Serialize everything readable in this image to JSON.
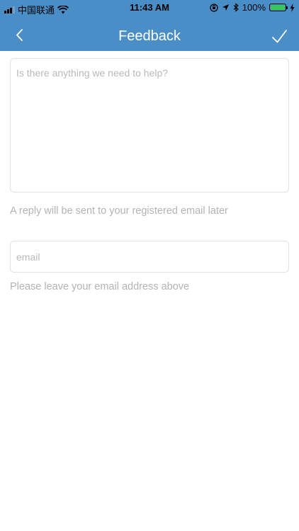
{
  "status_bar": {
    "carrier": "中国联通",
    "time": "11:43 AM",
    "battery": "100%",
    "icons": [
      "signal-icon",
      "wifi-icon",
      "rotation-lock-icon",
      "location-icon",
      "bluetooth-icon",
      "battery-icon",
      "charging-icon"
    ]
  },
  "nav": {
    "title": "Feedback",
    "back_icon": "chevron-left-icon",
    "confirm_icon": "checkmark-icon"
  },
  "form": {
    "message_placeholder": "Is there anything we need to help?",
    "message_value": "",
    "reply_hint": "A reply will be sent to your registered email later",
    "email_placeholder": "email",
    "email_value": "",
    "email_hint": "Please leave your email address above"
  },
  "colors": {
    "header": "#4a8ec8",
    "hint_text": "#b3b3b3",
    "border": "#e2e2e2"
  }
}
